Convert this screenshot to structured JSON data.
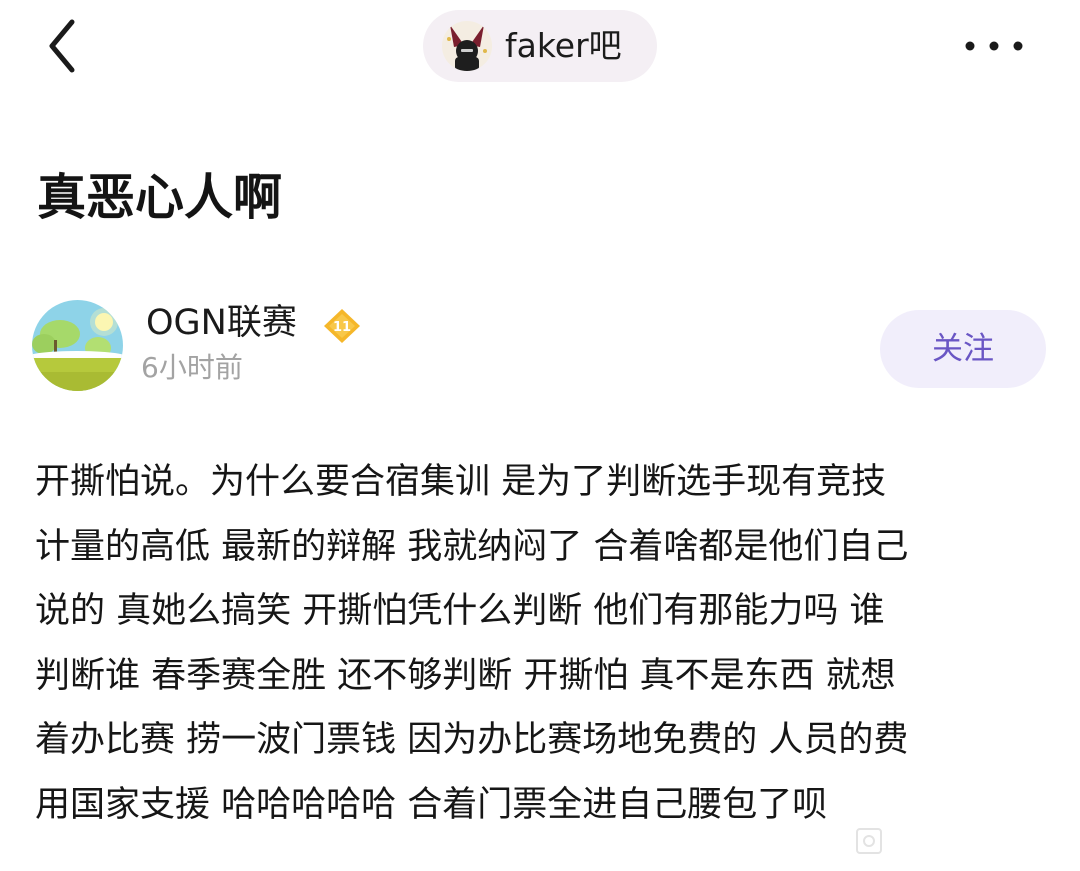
{
  "nav": {
    "back_icon": "chevron-left-icon",
    "forum_name": "faker吧",
    "forum_avatar_icon": "forum-avatar-image",
    "more_icon": "ellipsis-horizontal-icon"
  },
  "post": {
    "title": "真恶心人啊",
    "author": {
      "name": "OGN联赛",
      "level": "11",
      "time": "6小时前",
      "follow_label": "关注"
    },
    "body_lines": [
      "开撕怕说。为什么要合宿集训 是为了判断选手现有竞技",
      "计量的高低 最新的辩解 我就纳闷了 合着啥都是他们自己",
      "说的 真她么搞笑 开撕怕凭什么判断 他们有那能力吗 谁",
      "判断谁 春季赛全胜 还不够判断 开撕怕 真不是东西 就想",
      "着办比赛 捞一波门票钱 因为办比赛场地免费的 人员的费",
      "用国家支援 哈哈哈哈哈 合着门票全进自己腰包了呗"
    ]
  },
  "colors": {
    "follow_text": "#6a56c4",
    "follow_bg": "#f1eefb",
    "pill_bg": "#f4eff4",
    "badge": "#f5b72a",
    "time_text": "#a3a3a3"
  }
}
